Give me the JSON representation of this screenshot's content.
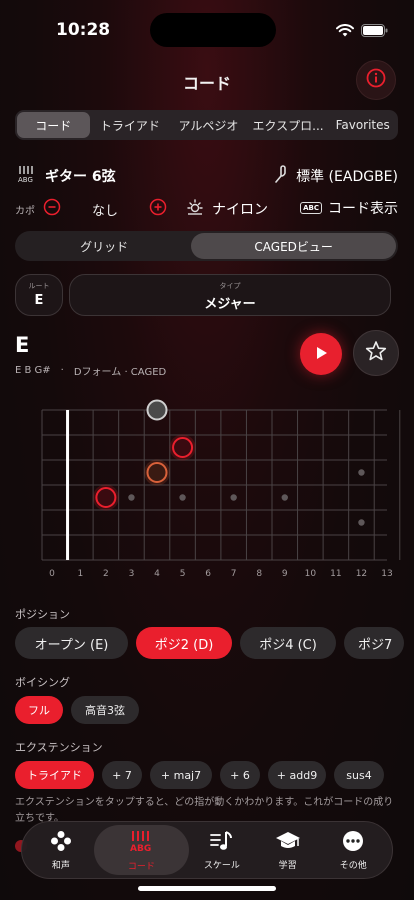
{
  "status": {
    "time": "10:28"
  },
  "header": {
    "title": "コード",
    "info_icon": "info-icon"
  },
  "mode_tabs": [
    {
      "label": "コード",
      "active": true
    },
    {
      "label": "トライアド",
      "active": false
    },
    {
      "label": "アルペジオ",
      "active": false
    },
    {
      "label": "エクスプロ...",
      "active": false
    },
    {
      "label": "Favorites",
      "active": false
    }
  ],
  "instrument": {
    "label": "ギター 6弦",
    "tuning": "標準 (EADGBE)"
  },
  "options": {
    "capo_label": "カポ",
    "capo_value": "なし",
    "string_type": "ナイロン",
    "display_label": "コード表示",
    "display_badge": "ABC"
  },
  "view_tabs": [
    {
      "label": "グリッド",
      "active": false
    },
    {
      "label": "CAGEDビュー",
      "active": true
    }
  ],
  "selector": {
    "root_caption": "ルート",
    "root_value": "E",
    "type_caption": "タイプ",
    "type_value": "メジャー"
  },
  "chord": {
    "name": "E",
    "notes": "E  B  G#",
    "separator": "·",
    "form": "Dフォーム · CAGED"
  },
  "fretboard": {
    "fret_numbers": [
      "0",
      "1",
      "2",
      "3",
      "4",
      "5",
      "6",
      "7",
      "8",
      "9",
      "10",
      "11",
      "12",
      "13"
    ],
    "markers": [
      {
        "string": 4,
        "fret": 3
      },
      {
        "string": 4,
        "fret": 5
      },
      {
        "string": 4,
        "fret": 7
      },
      {
        "string": 4,
        "fret": 9
      },
      {
        "string": 3,
        "fret": 12
      },
      {
        "string": 5,
        "fret": 12
      }
    ],
    "notes": [
      {
        "string": 1,
        "fret": 4,
        "style": "open-gray"
      },
      {
        "string": 2,
        "fret": 5,
        "style": "red"
      },
      {
        "string": 3,
        "fret": 4,
        "style": "orange"
      },
      {
        "string": 4,
        "fret": 2,
        "style": "red"
      }
    ]
  },
  "positions": {
    "title": "ポジション",
    "items": [
      {
        "label": "オープン (E)",
        "active": false
      },
      {
        "label": "ポジ2 (D)",
        "active": true
      },
      {
        "label": "ポジ4 (C)",
        "active": false
      },
      {
        "label": "ポジ7",
        "active": false
      }
    ]
  },
  "voicing": {
    "title": "ボイシング",
    "items": [
      {
        "label": "フル",
        "active": true
      },
      {
        "label": "高音3弦",
        "active": false
      }
    ]
  },
  "extensions": {
    "title": "エクステンション",
    "items": [
      {
        "label": "トライアド",
        "active": true
      },
      {
        "label": "+ 7",
        "active": false
      },
      {
        "label": "+ maj7",
        "active": false
      },
      {
        "label": "+ 6",
        "active": false
      },
      {
        "label": "+ add9",
        "active": false
      },
      {
        "label": "sus4",
        "active": false
      }
    ],
    "hint": "エクステンションをタップすると、どの指が動くかわかります。これがコードの成り立ちです。"
  },
  "tabbar": [
    {
      "label": "和声",
      "icon": "harmony-icon",
      "active": false
    },
    {
      "label": "コード",
      "icon": "guitar-chord-icon",
      "active": true
    },
    {
      "label": "スケール",
      "icon": "scale-icon",
      "active": false
    },
    {
      "label": "学習",
      "icon": "graduation-cap-icon",
      "active": false
    },
    {
      "label": "その他",
      "icon": "more-icon",
      "active": false
    }
  ],
  "colors": {
    "accent": "#ea1f2d",
    "note_orange": "#d9613a",
    "note_gray": "#8e8e8e"
  }
}
